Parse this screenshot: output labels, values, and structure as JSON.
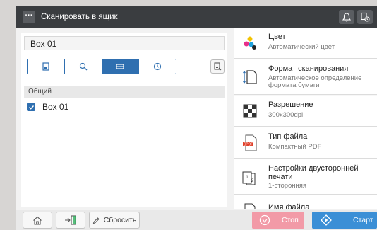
{
  "titlebar": {
    "title": "Сканировать в ящик",
    "menu_label": "···"
  },
  "left": {
    "box_name": "Box 01",
    "tabs": [
      {
        "icon": "box-icon"
      },
      {
        "icon": "search-icon"
      },
      {
        "icon": "tray-icon",
        "active": true
      },
      {
        "icon": "clock-icon"
      }
    ],
    "section": "Общий",
    "rows": [
      {
        "label": "Box 01",
        "checked": true
      }
    ]
  },
  "right": {
    "items": [
      {
        "title": "Цвет",
        "sub": "Автоматический цвет",
        "icon": "color-icon"
      },
      {
        "title": "Формат сканирования",
        "sub": "Автоматическое определение формата бумаги",
        "icon": "scan-size-icon"
      },
      {
        "title": "Разрешение",
        "sub": "300x300dpi",
        "icon": "resolution-icon"
      },
      {
        "title": "Тип файла",
        "sub": "Компактный PDF",
        "icon": "pdf-icon",
        "icon_text": "CPDF"
      },
      {
        "title": "Настройки двусторонней печати",
        "sub": "1-сторонняя",
        "icon": "duplex-icon"
      },
      {
        "title": "Имя файла",
        "sub": "",
        "icon": "file-icon"
      }
    ]
  },
  "bottom": {
    "reset": "Сбросить",
    "stop": "Стоп",
    "start": "Старт"
  },
  "colors": {
    "accent": "#2f6fb0",
    "stop": "#f29aa7",
    "start": "#3b8fd6",
    "titlebar": "#3a3d40"
  }
}
